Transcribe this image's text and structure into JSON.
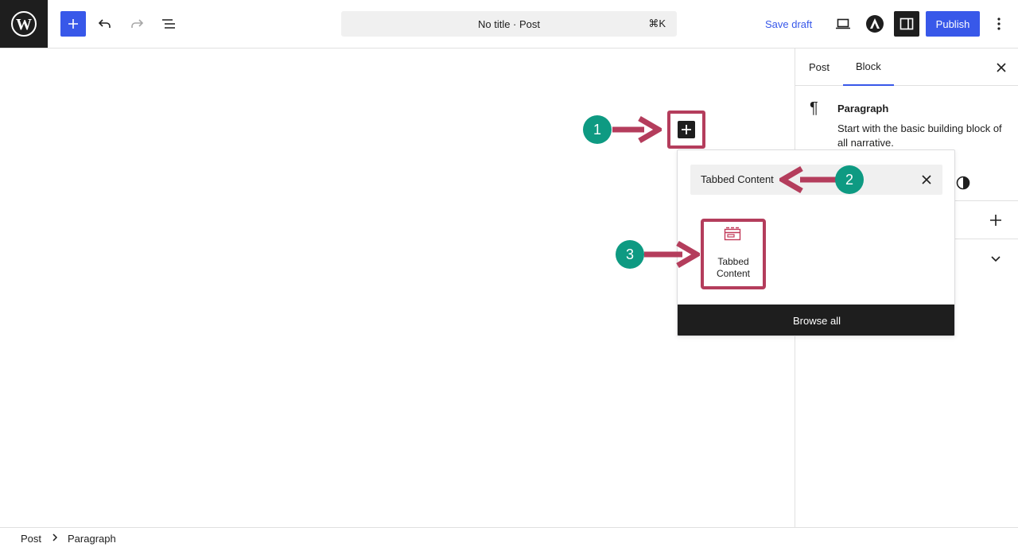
{
  "toolbar": {
    "doc_title": "No title · Post",
    "shortcut": "⌘K",
    "save_draft": "Save draft",
    "publish": "Publish"
  },
  "icons": {
    "logo": "wordpress-icon",
    "inserter": "plus-icon",
    "undo": "undo-icon",
    "redo": "redo-icon",
    "list_view": "list-view-icon",
    "preview": "laptop-icon",
    "astra": "astra-icon",
    "settings": "sidebar-icon",
    "options": "more-vertical-icon"
  },
  "sidebar": {
    "tabs": [
      "Post",
      "Block"
    ],
    "active_tab": "Block",
    "block_title": "Paragraph",
    "block_description": "Start with the basic building block of all narrative."
  },
  "inserter": {
    "search_value": "Tabbed Content",
    "result_label": "Tabbed Content",
    "browse_all": "Browse all"
  },
  "markers": [
    "1",
    "2",
    "3"
  ],
  "breadcrumb": [
    "Post",
    "Paragraph"
  ],
  "colors": {
    "accent": "#3858e9",
    "annotation": "#b43d5c",
    "marker": "#0e9a82",
    "dark": "#1e1e1e"
  }
}
